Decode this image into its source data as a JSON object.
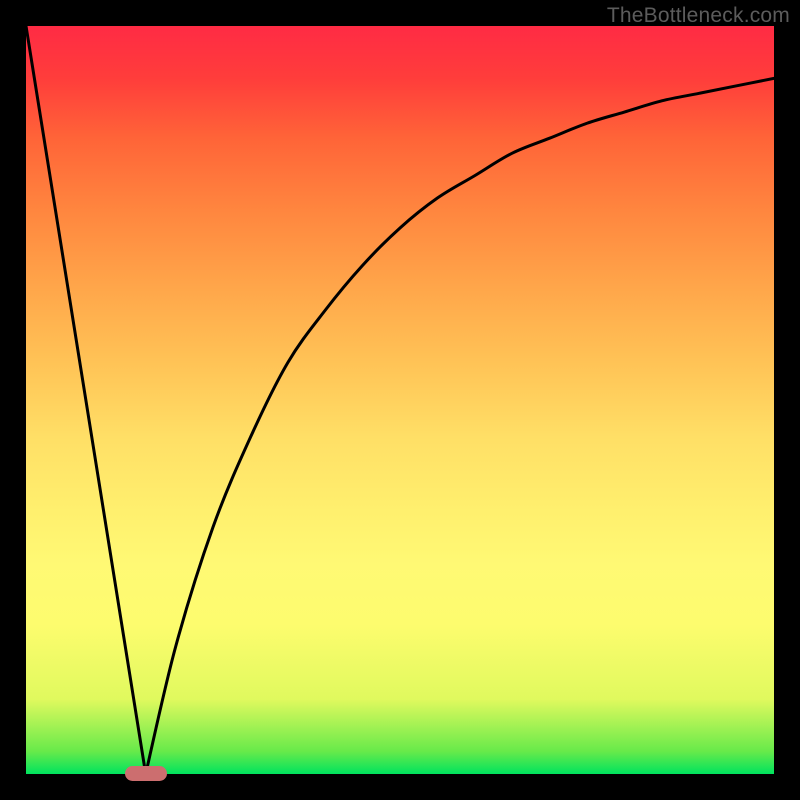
{
  "watermark": "TheBottleneck.com",
  "chart_data": {
    "type": "line",
    "title": "",
    "xlabel": "",
    "ylabel": "",
    "xlim": [
      0,
      100
    ],
    "ylim": [
      0,
      100
    ],
    "grid": false,
    "legend": false,
    "series": [
      {
        "name": "left-line",
        "x": [
          0,
          16
        ],
        "y": [
          100,
          0
        ]
      },
      {
        "name": "right-curve",
        "x": [
          16,
          20,
          25,
          30,
          35,
          40,
          45,
          50,
          55,
          60,
          65,
          70,
          75,
          80,
          85,
          90,
          95,
          100
        ],
        "y": [
          0,
          17,
          33,
          45,
          55,
          62,
          68,
          73,
          77,
          80,
          83,
          85,
          87,
          88.5,
          90,
          91,
          92,
          93
        ]
      }
    ],
    "marker": {
      "x": 16,
      "y": 0,
      "color": "#cc6e6f"
    },
    "background_gradient": {
      "direction": "vertical",
      "stops": [
        {
          "pos": 0,
          "color": "#00e35e"
        },
        {
          "pos": 0.28,
          "color": "#fff974"
        },
        {
          "pos": 0.65,
          "color": "#ffa64a"
        },
        {
          "pos": 1.0,
          "color": "#ff2b44"
        }
      ]
    }
  }
}
